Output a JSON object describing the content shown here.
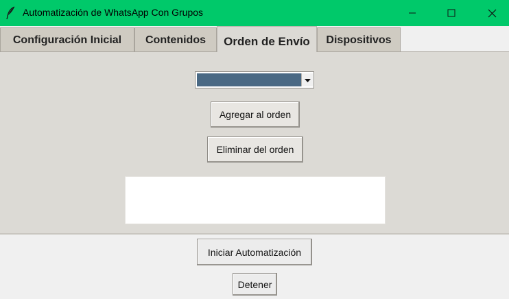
{
  "window": {
    "title": "Automatización de WhatsApp Con Grupos",
    "icon": "feather-icon",
    "accent_color": "#00c96a"
  },
  "tabs": [
    {
      "label": "Configuración Inicial",
      "active": false
    },
    {
      "label": "Contenidos",
      "active": false
    },
    {
      "label": "Orden de Envío",
      "active": true
    },
    {
      "label": "Dispositivos",
      "active": false
    }
  ],
  "order_tab": {
    "combo_value": "",
    "add_label": "Agregar al orden",
    "remove_label": "Eliminar del orden",
    "order_items": []
  },
  "footer": {
    "start_label": "Iniciar Automatización",
    "stop_label": "Detener"
  }
}
